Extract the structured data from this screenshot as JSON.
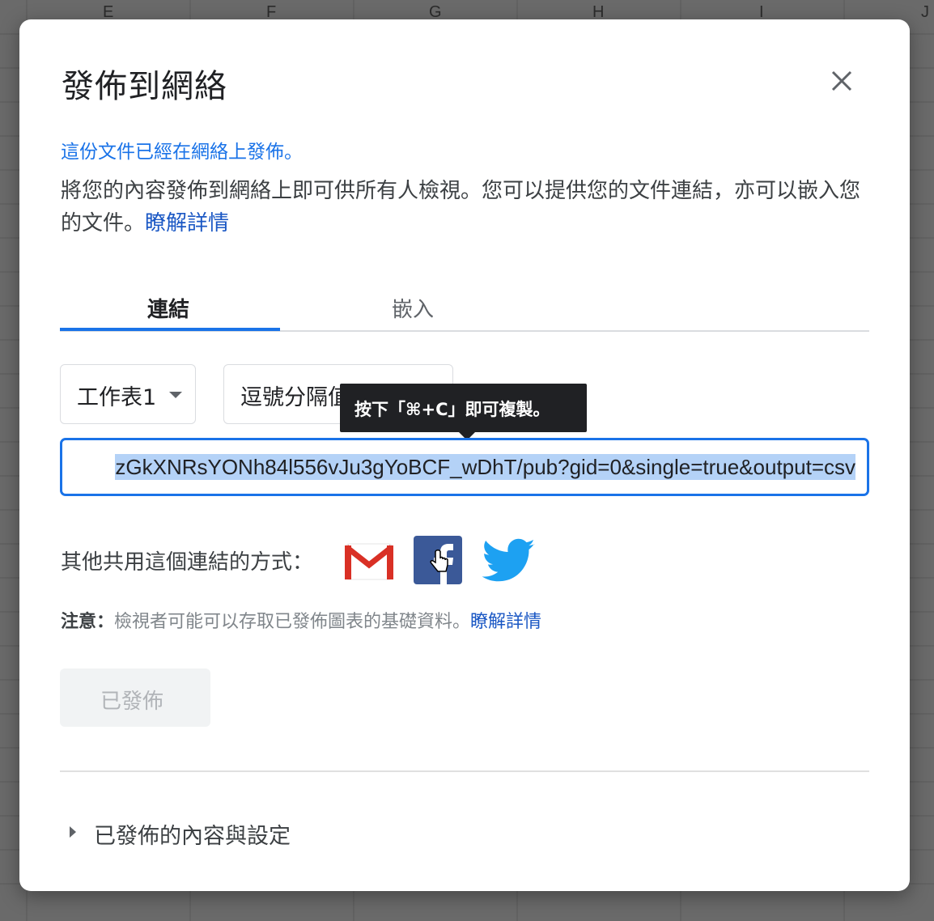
{
  "background_sheet": {
    "column_letters": [
      "E",
      "F",
      "G",
      "H",
      "I",
      "J"
    ]
  },
  "dialog": {
    "title": "發佈到網絡",
    "close_icon": "close-icon",
    "status_text": "這份文件已經在網絡上發佈。",
    "description": "將您的內容發佈到網絡上即可供所有人檢視。您可以提供您的文件連結，亦可以嵌入您的文件。",
    "learn_more": "瞭解詳情",
    "tabs": [
      {
        "label": "連結",
        "active": true
      },
      {
        "label": "嵌入",
        "active": false
      }
    ],
    "sheet_select": {
      "value": "工作表1"
    },
    "format_select": {
      "value": "逗號分隔值"
    },
    "tooltip": "按下「⌘+C」即可複製。",
    "url_value": "zGkXNRsYONh84l556vJu3gYoBCF_wDhT/pub?gid=0&single=true&output=csv",
    "share_label": "其他共用這個連結的方式：",
    "share_icons": [
      "gmail-icon",
      "facebook-icon",
      "twitter-icon"
    ],
    "note_label": "注意：",
    "note_text": "檢視者可能可以存取已發佈圖表的基礎資料。",
    "note_link": "瞭解詳情",
    "published_button": "已發佈",
    "expander_label": "已發佈的內容與設定"
  },
  "colors": {
    "accent": "#1a73e8",
    "link": "#1a57c4",
    "facebook": "#3b5998",
    "twitter": "#1da1f2",
    "gmail_red": "#d93025"
  }
}
